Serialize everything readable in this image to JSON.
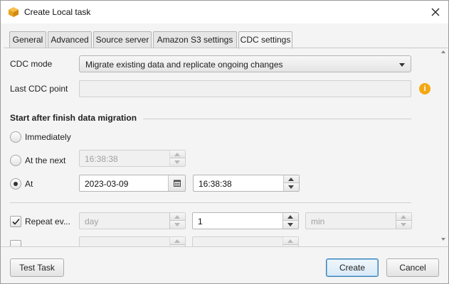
{
  "window": {
    "title": "Create Local task",
    "accent_color": "#f3a814",
    "app_icon": "cube-icon",
    "close_icon": "close-icon"
  },
  "tabs": [
    {
      "label": "General",
      "active": false
    },
    {
      "label": "Advanced",
      "active": false
    },
    {
      "label": "Source server",
      "active": false
    },
    {
      "label": "Amazon S3 settings",
      "active": false
    },
    {
      "label": "CDC settings",
      "active": true
    }
  ],
  "cdc": {
    "mode_label": "CDC mode",
    "mode_value": "Migrate existing data and replicate ongoing changes",
    "last_point_label": "Last CDC point",
    "last_point_value": "",
    "info_icon": "i"
  },
  "start_section": {
    "heading": "Start after finish data migration",
    "immediately_label": "Immediately",
    "at_the_next_label": "At the next",
    "at_the_next_time": "16:38:38",
    "at_label": "At",
    "at_date": "2023-03-09",
    "at_time": "16:38:38",
    "selected": "At"
  },
  "repeat": {
    "label": "Repeat ev...",
    "checked": true,
    "unit_placeholder": "day",
    "count": "1",
    "interval_placeholder": "min"
  },
  "footer": {
    "test_label": "Test Task",
    "create_label": "Create",
    "cancel_label": "Cancel"
  }
}
